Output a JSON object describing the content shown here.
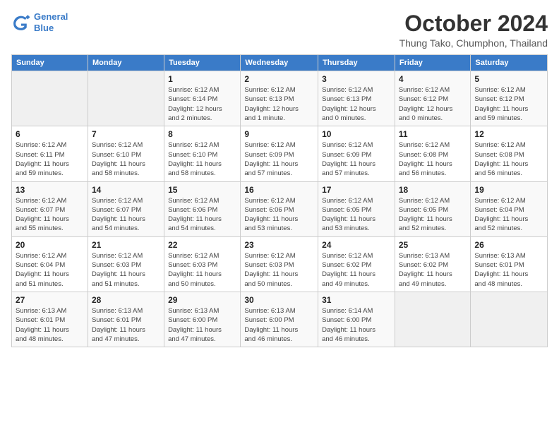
{
  "logo": {
    "line1": "General",
    "line2": "Blue"
  },
  "title": "October 2024",
  "location": "Thung Tako, Chumphon, Thailand",
  "headers": [
    "Sunday",
    "Monday",
    "Tuesday",
    "Wednesday",
    "Thursday",
    "Friday",
    "Saturday"
  ],
  "weeks": [
    [
      {
        "day": "",
        "info": ""
      },
      {
        "day": "",
        "info": ""
      },
      {
        "day": "1",
        "info": "Sunrise: 6:12 AM\nSunset: 6:14 PM\nDaylight: 12 hours\nand 2 minutes."
      },
      {
        "day": "2",
        "info": "Sunrise: 6:12 AM\nSunset: 6:13 PM\nDaylight: 12 hours\nand 1 minute."
      },
      {
        "day": "3",
        "info": "Sunrise: 6:12 AM\nSunset: 6:13 PM\nDaylight: 12 hours\nand 0 minutes."
      },
      {
        "day": "4",
        "info": "Sunrise: 6:12 AM\nSunset: 6:12 PM\nDaylight: 12 hours\nand 0 minutes."
      },
      {
        "day": "5",
        "info": "Sunrise: 6:12 AM\nSunset: 6:12 PM\nDaylight: 11 hours\nand 59 minutes."
      }
    ],
    [
      {
        "day": "6",
        "info": "Sunrise: 6:12 AM\nSunset: 6:11 PM\nDaylight: 11 hours\nand 59 minutes."
      },
      {
        "day": "7",
        "info": "Sunrise: 6:12 AM\nSunset: 6:10 PM\nDaylight: 11 hours\nand 58 minutes."
      },
      {
        "day": "8",
        "info": "Sunrise: 6:12 AM\nSunset: 6:10 PM\nDaylight: 11 hours\nand 58 minutes."
      },
      {
        "day": "9",
        "info": "Sunrise: 6:12 AM\nSunset: 6:09 PM\nDaylight: 11 hours\nand 57 minutes."
      },
      {
        "day": "10",
        "info": "Sunrise: 6:12 AM\nSunset: 6:09 PM\nDaylight: 11 hours\nand 57 minutes."
      },
      {
        "day": "11",
        "info": "Sunrise: 6:12 AM\nSunset: 6:08 PM\nDaylight: 11 hours\nand 56 minutes."
      },
      {
        "day": "12",
        "info": "Sunrise: 6:12 AM\nSunset: 6:08 PM\nDaylight: 11 hours\nand 56 minutes."
      }
    ],
    [
      {
        "day": "13",
        "info": "Sunrise: 6:12 AM\nSunset: 6:07 PM\nDaylight: 11 hours\nand 55 minutes."
      },
      {
        "day": "14",
        "info": "Sunrise: 6:12 AM\nSunset: 6:07 PM\nDaylight: 11 hours\nand 54 minutes."
      },
      {
        "day": "15",
        "info": "Sunrise: 6:12 AM\nSunset: 6:06 PM\nDaylight: 11 hours\nand 54 minutes."
      },
      {
        "day": "16",
        "info": "Sunrise: 6:12 AM\nSunset: 6:06 PM\nDaylight: 11 hours\nand 53 minutes."
      },
      {
        "day": "17",
        "info": "Sunrise: 6:12 AM\nSunset: 6:05 PM\nDaylight: 11 hours\nand 53 minutes."
      },
      {
        "day": "18",
        "info": "Sunrise: 6:12 AM\nSunset: 6:05 PM\nDaylight: 11 hours\nand 52 minutes."
      },
      {
        "day": "19",
        "info": "Sunrise: 6:12 AM\nSunset: 6:04 PM\nDaylight: 11 hours\nand 52 minutes."
      }
    ],
    [
      {
        "day": "20",
        "info": "Sunrise: 6:12 AM\nSunset: 6:04 PM\nDaylight: 11 hours\nand 51 minutes."
      },
      {
        "day": "21",
        "info": "Sunrise: 6:12 AM\nSunset: 6:03 PM\nDaylight: 11 hours\nand 51 minutes."
      },
      {
        "day": "22",
        "info": "Sunrise: 6:12 AM\nSunset: 6:03 PM\nDaylight: 11 hours\nand 50 minutes."
      },
      {
        "day": "23",
        "info": "Sunrise: 6:12 AM\nSunset: 6:03 PM\nDaylight: 11 hours\nand 50 minutes."
      },
      {
        "day": "24",
        "info": "Sunrise: 6:12 AM\nSunset: 6:02 PM\nDaylight: 11 hours\nand 49 minutes."
      },
      {
        "day": "25",
        "info": "Sunrise: 6:13 AM\nSunset: 6:02 PM\nDaylight: 11 hours\nand 49 minutes."
      },
      {
        "day": "26",
        "info": "Sunrise: 6:13 AM\nSunset: 6:01 PM\nDaylight: 11 hours\nand 48 minutes."
      }
    ],
    [
      {
        "day": "27",
        "info": "Sunrise: 6:13 AM\nSunset: 6:01 PM\nDaylight: 11 hours\nand 48 minutes."
      },
      {
        "day": "28",
        "info": "Sunrise: 6:13 AM\nSunset: 6:01 PM\nDaylight: 11 hours\nand 47 minutes."
      },
      {
        "day": "29",
        "info": "Sunrise: 6:13 AM\nSunset: 6:00 PM\nDaylight: 11 hours\nand 47 minutes."
      },
      {
        "day": "30",
        "info": "Sunrise: 6:13 AM\nSunset: 6:00 PM\nDaylight: 11 hours\nand 46 minutes."
      },
      {
        "day": "31",
        "info": "Sunrise: 6:14 AM\nSunset: 6:00 PM\nDaylight: 11 hours\nand 46 minutes."
      },
      {
        "day": "",
        "info": ""
      },
      {
        "day": "",
        "info": ""
      }
    ]
  ]
}
